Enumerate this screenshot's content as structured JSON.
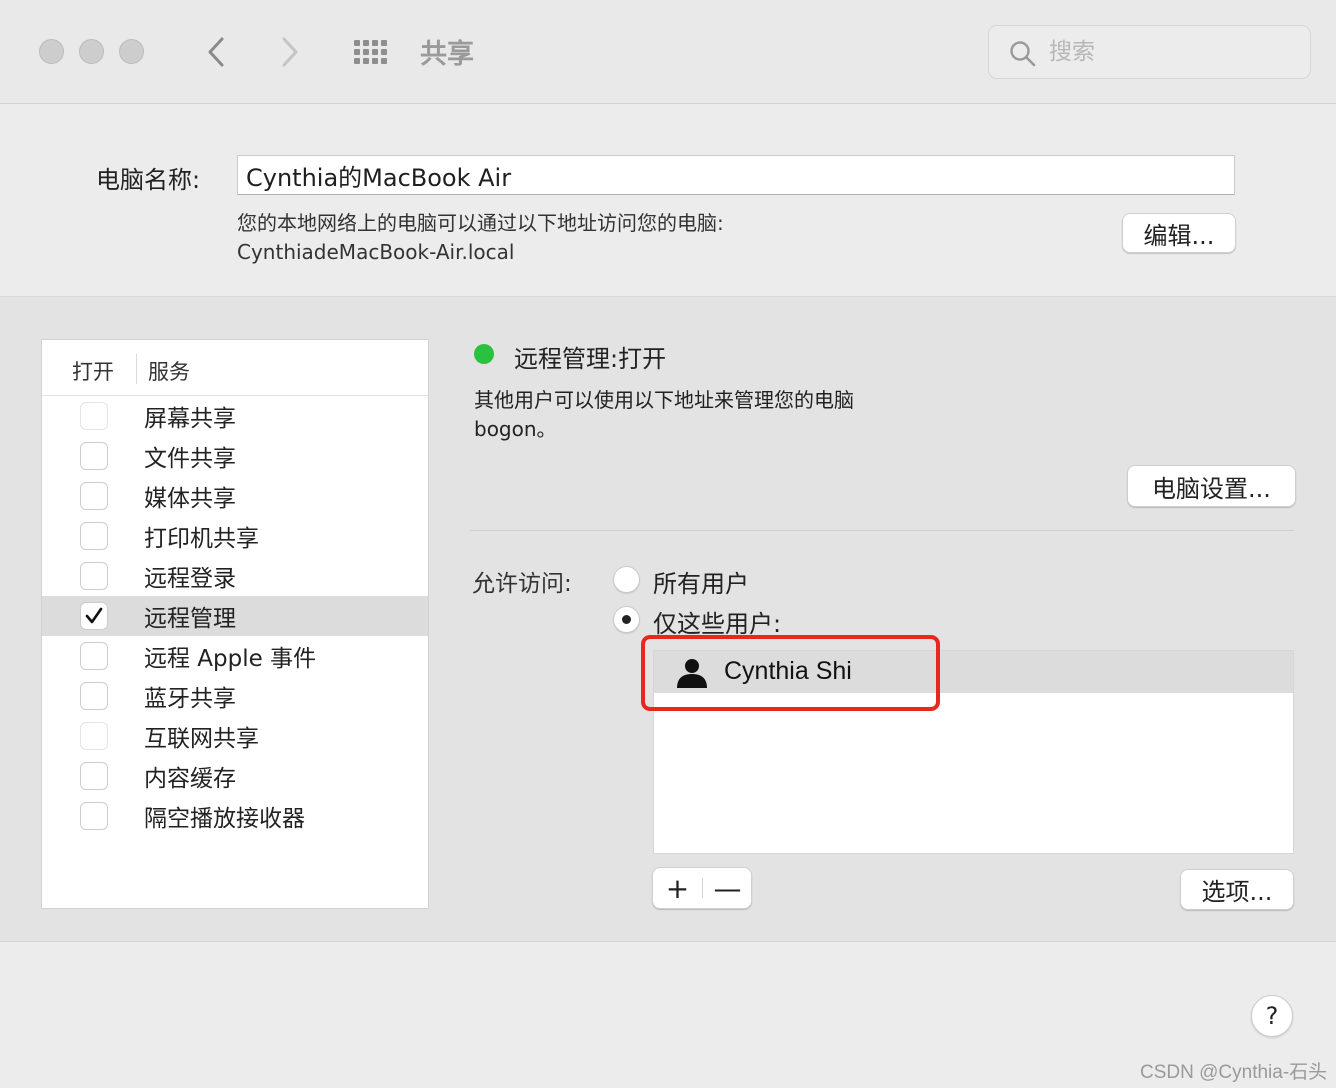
{
  "window": {
    "title": "共享",
    "search_placeholder": "搜索"
  },
  "computer": {
    "name_label": "电脑名称:",
    "name_value": "Cynthia的MacBook Air",
    "hint_line1": "您的本地网络上的电脑可以通过以下地址访问您的电脑:",
    "hint_line2": "CynthiadeMacBook-Air.local",
    "edit_button": "编辑..."
  },
  "services": {
    "header_open": "打开",
    "header_service": "服务",
    "items": [
      {
        "label": "屏幕共享",
        "checked": false,
        "enabled": false
      },
      {
        "label": "文件共享",
        "checked": false,
        "enabled": true
      },
      {
        "label": "媒体共享",
        "checked": false,
        "enabled": true
      },
      {
        "label": "打印机共享",
        "checked": false,
        "enabled": true
      },
      {
        "label": "远程登录",
        "checked": false,
        "enabled": true
      },
      {
        "label": "远程管理",
        "checked": true,
        "enabled": true,
        "selected": true
      },
      {
        "label": "远程 Apple 事件",
        "checked": false,
        "enabled": true
      },
      {
        "label": "蓝牙共享",
        "checked": false,
        "enabled": true
      },
      {
        "label": "互联网共享",
        "checked": false,
        "enabled": false
      },
      {
        "label": "内容缓存",
        "checked": false,
        "enabled": true
      },
      {
        "label": "隔空播放接收器",
        "checked": false,
        "enabled": true
      }
    ]
  },
  "detail": {
    "status_text": "远程管理:打开",
    "status_color": "#29c240",
    "desc_line1": "其他用户可以使用以下地址来管理您的电脑",
    "desc_line2": "bogon。",
    "computer_settings_button": "电脑设置...",
    "access_label": "允许访问:",
    "radio_all": "所有用户",
    "radio_only": "仅这些用户:",
    "radio_selected": "only",
    "users": [
      {
        "name": "Cynthia Shi"
      }
    ],
    "add_button": "+",
    "remove_button": "—",
    "options_button": "选项..."
  },
  "help_button": "?",
  "watermark": "CSDN @Cynthia-石头",
  "colors": {
    "highlight": "#e8281c",
    "accent_green": "#29c240"
  }
}
